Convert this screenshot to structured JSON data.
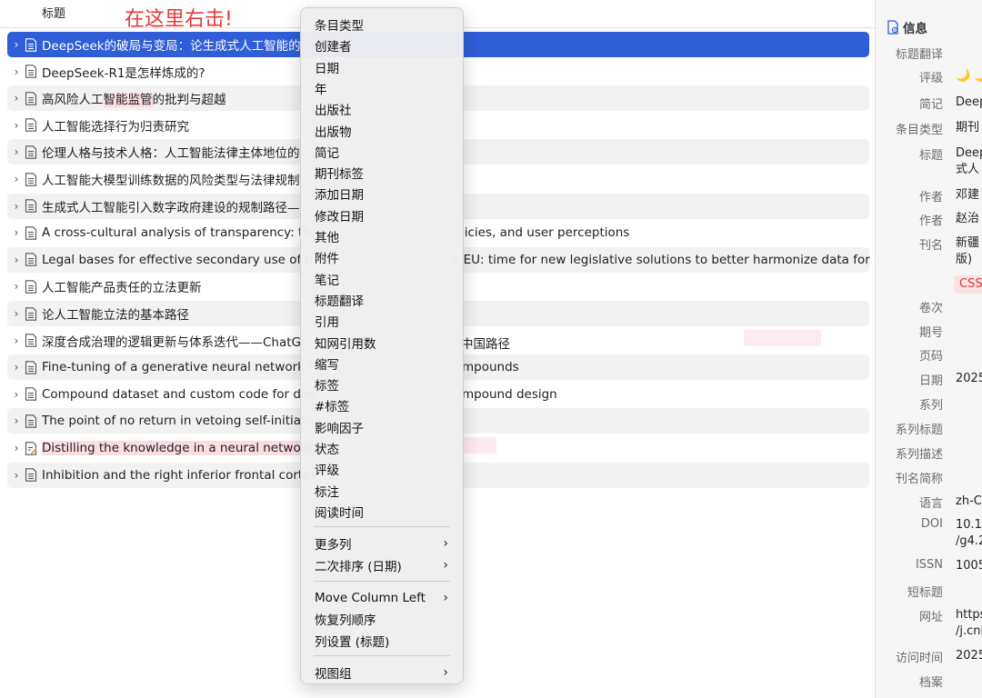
{
  "header": {
    "title_column": "标题",
    "annotation": "在这里右击!"
  },
  "rows": [
    {
      "text": "DeepSeek的破局与变局：论生成式人工智能的",
      "selected": true
    },
    {
      "text": "DeepSeek-R1是怎样炼成的?"
    },
    {
      "pre": "高风险人工",
      "hl": "智能监管",
      "post": "的批判与超越"
    },
    {
      "text": "人工智能选择行为归责研究"
    },
    {
      "text": "伦理人格与技术人格：人工智能法律主体地位的"
    },
    {
      "text": "人工智能大模型训练数据的风险类型与法律规制"
    },
    {
      "text": "生成式人工智能引入数字政府建设的规制路径—"
    },
    {
      "text": "A cross-cultural analysis of transparency: th",
      "tail": "licies, and user perceptions"
    },
    {
      "text": "Legal bases for effective secondary use of h",
      "tail": "e EU: time for new legislative solutions to better harmonize data for c"
    },
    {
      "text": "人工智能产品责任的立法更新"
    },
    {
      "text": "论人工智能立法的基本路径"
    },
    {
      "text": "深度合成治理的逻辑更新与体系迭代——ChatG",
      "tail": "中国路径"
    },
    {
      "text": "Fine-tuning of a generative neural network fo",
      "tail": "mpounds"
    },
    {
      "text": "Compound dataset and custom code for dee",
      "tail": "mpound design"
    },
    {
      "text": "The point of no return in vetoing self-initiate"
    },
    {
      "hl": "Distilling the knowledge in a neural network",
      "pre": "",
      "post": ""
    },
    {
      "text": "Inhibition and the right inferior frontal cortex"
    }
  ],
  "menu": {
    "items": [
      "条目类型",
      "创建者",
      "日期",
      "年",
      "出版社",
      "出版物",
      "简记",
      "期刊标签",
      "添加日期",
      "修改日期",
      "其他",
      "附件",
      "笔记",
      "标题翻译",
      "引用",
      "知网引用数",
      "缩写",
      "标签",
      "#标签",
      "影响因子",
      "状态",
      "评级",
      "标注",
      "阅读时间"
    ],
    "group2": [
      {
        "label": "更多列",
        "arrow": "›"
      },
      {
        "label": "二次排序 (日期)",
        "arrow": "›"
      }
    ],
    "group3": [
      {
        "label": "Move Column Left",
        "arrow": "›"
      },
      {
        "label": "恢复列顺序"
      },
      {
        "label": "列设置 (标题)"
      }
    ],
    "group4": [
      {
        "label": "视图组",
        "arrow": "›"
      }
    ]
  },
  "info": {
    "heading": "信息",
    "fields": [
      {
        "label": "标题翻译",
        "value": ""
      },
      {
        "label": "评级",
        "value": "🌙 🌙"
      },
      {
        "label": "简记",
        "value": "Deep"
      },
      {
        "label": "条目类型",
        "value": "期刊"
      },
      {
        "label": "标题",
        "value": "Deep\n式人"
      },
      {
        "label": "作者",
        "value": "邓建"
      },
      {
        "label": "作者",
        "value": "赵治"
      },
      {
        "label": "刊名",
        "value": "新疆\n版)"
      },
      {
        "label": "卷次",
        "value": ""
      },
      {
        "label": "期号",
        "value": ""
      },
      {
        "label": "页码",
        "value": ""
      },
      {
        "label": "日期",
        "value": "2025"
      },
      {
        "label": "系列",
        "value": ""
      },
      {
        "label": "系列标题",
        "value": ""
      },
      {
        "label": "系列描述",
        "value": ""
      },
      {
        "label": "刊名简称",
        "value": ""
      },
      {
        "label": "语言",
        "value": "zh-C"
      },
      {
        "label": "DOI",
        "value": "10.14\n/g4.2"
      },
      {
        "label": "ISSN",
        "value": "1005"
      },
      {
        "label": "短标题",
        "value": ""
      },
      {
        "label": "网址",
        "value": "https\n/j.cnk"
      },
      {
        "label": "访问时间",
        "value": "2025"
      },
      {
        "label": "档案",
        "value": ""
      }
    ],
    "tag": "CSS"
  }
}
